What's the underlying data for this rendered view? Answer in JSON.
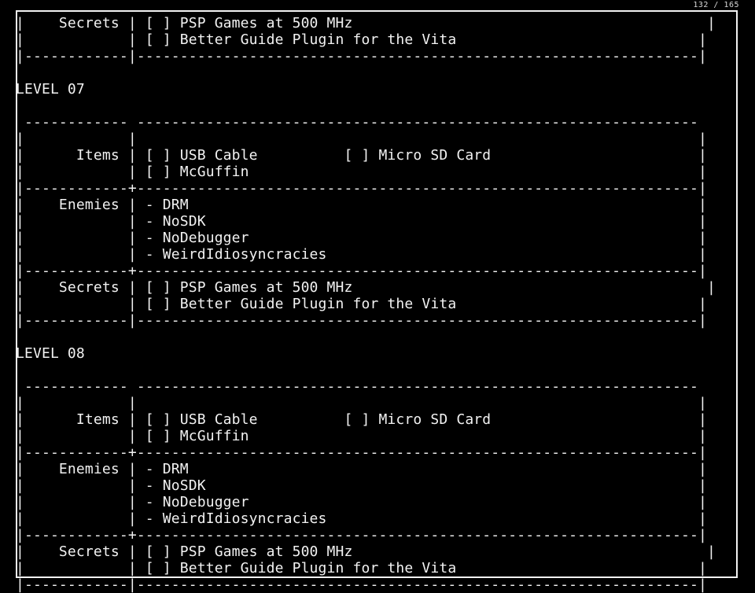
{
  "page_counter": "132 / 165",
  "lines": [
    {
      "kind": "text",
      "name": "secrets-row",
      "text": "|    Secrets | [ ] PSP Games at 500 MHz                                         |"
    },
    {
      "kind": "text",
      "name": "secrets-row",
      "text": "|            | [ ] Better Guide Plugin for the Vita                            |"
    },
    {
      "kind": "rule",
      "name": "table-rule",
      "text": "|------------|-----------------------------------------------------------------|"
    },
    {
      "kind": "blank",
      "name": "blank-line",
      "text": ""
    },
    {
      "kind": "title",
      "name": "level-title",
      "text": "LEVEL 07"
    },
    {
      "kind": "blank",
      "name": "blank-line",
      "text": ""
    },
    {
      "kind": "rule",
      "name": "table-rule",
      "text": " ------------ -----------------------------------------------------------------"
    },
    {
      "kind": "text",
      "name": "spacer-row",
      "text": "|            |                                                                 |"
    },
    {
      "kind": "text",
      "name": "items-row",
      "text": "|      Items | [ ] USB Cable          [ ] Micro SD Card                        |"
    },
    {
      "kind": "text",
      "name": "items-row",
      "text": "|            | [ ] McGuffin                                                    |"
    },
    {
      "kind": "rule",
      "name": "table-rule",
      "text": "|------------+-----------------------------------------------------------------|"
    },
    {
      "kind": "text",
      "name": "enemies-row",
      "text": "|    Enemies | - DRM                                                           |"
    },
    {
      "kind": "text",
      "name": "enemies-row",
      "text": "|            | - NoSDK                                                         |"
    },
    {
      "kind": "text",
      "name": "enemies-row",
      "text": "|            | - NoDebugger                                                    |"
    },
    {
      "kind": "text",
      "name": "enemies-row",
      "text": "|            | - WeirdIdiosyncracies                                           |"
    },
    {
      "kind": "rule",
      "name": "table-rule",
      "text": "|------------+-----------------------------------------------------------------|"
    },
    {
      "kind": "text",
      "name": "secrets-row",
      "text": "|    Secrets | [ ] PSP Games at 500 MHz                                         |"
    },
    {
      "kind": "text",
      "name": "secrets-row",
      "text": "|            | [ ] Better Guide Plugin for the Vita                            |"
    },
    {
      "kind": "rule",
      "name": "table-rule",
      "text": "|------------|-----------------------------------------------------------------|"
    },
    {
      "kind": "blank",
      "name": "blank-line",
      "text": ""
    },
    {
      "kind": "title",
      "name": "level-title",
      "text": "LEVEL 08"
    },
    {
      "kind": "blank",
      "name": "blank-line",
      "text": ""
    },
    {
      "kind": "rule",
      "name": "table-rule",
      "text": " ------------ -----------------------------------------------------------------"
    },
    {
      "kind": "text",
      "name": "spacer-row",
      "text": "|            |                                                                 |"
    },
    {
      "kind": "text",
      "name": "items-row",
      "text": "|      Items | [ ] USB Cable          [ ] Micro SD Card                        |"
    },
    {
      "kind": "text",
      "name": "items-row",
      "text": "|            | [ ] McGuffin                                                    |"
    },
    {
      "kind": "rule",
      "name": "table-rule",
      "text": "|------------+-----------------------------------------------------------------|"
    },
    {
      "kind": "text",
      "name": "enemies-row",
      "text": "|    Enemies | - DRM                                                           |"
    },
    {
      "kind": "text",
      "name": "enemies-row",
      "text": "|            | - NoSDK                                                         |"
    },
    {
      "kind": "text",
      "name": "enemies-row",
      "text": "|            | - NoDebugger                                                    |"
    },
    {
      "kind": "text",
      "name": "enemies-row",
      "text": "|            | - WeirdIdiosyncracies                                           |"
    },
    {
      "kind": "rule",
      "name": "table-rule",
      "text": "|------------+-----------------------------------------------------------------|"
    },
    {
      "kind": "text",
      "name": "secrets-row",
      "text": "|    Secrets | [ ] PSP Games at 500 MHz                                         |"
    },
    {
      "kind": "text",
      "name": "secrets-row",
      "text": "|            | [ ] Better Guide Plugin for the Vita                            |"
    },
    {
      "kind": "rule",
      "name": "table-rule",
      "text": "|------------|-----------------------------------------------------------------|"
    }
  ]
}
